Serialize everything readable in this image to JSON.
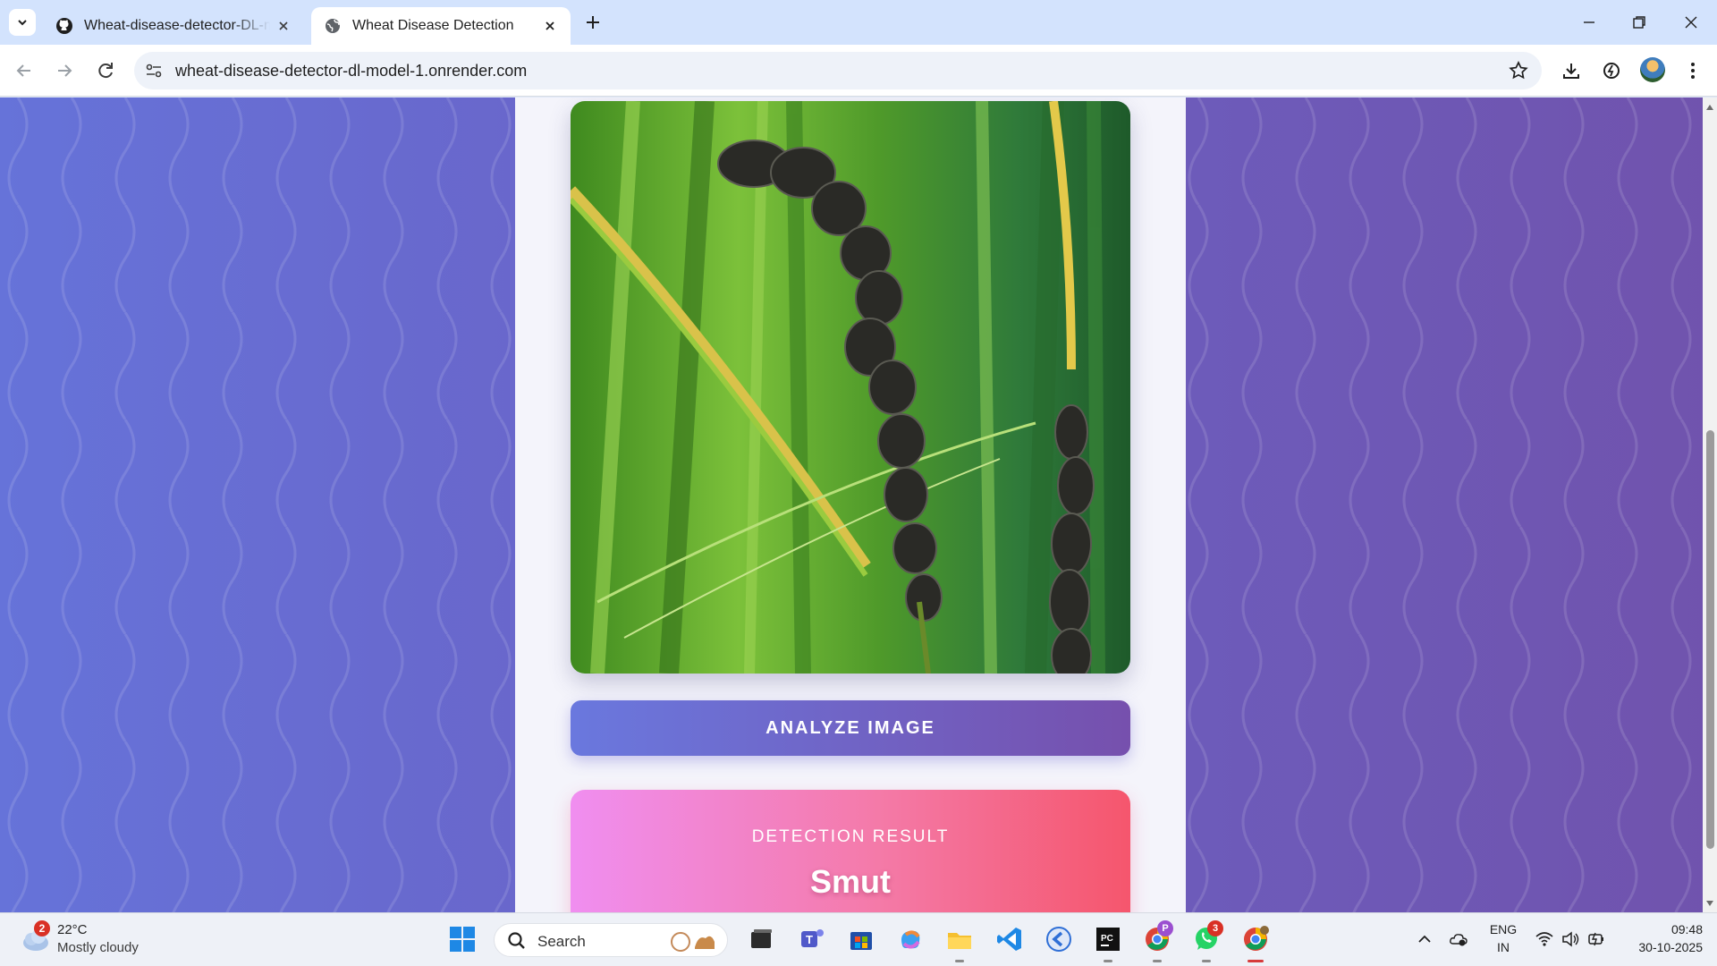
{
  "browser": {
    "tabs": [
      {
        "title": "Wheat-disease-detector-DL-model",
        "active": false
      },
      {
        "title": "Wheat Disease Detection",
        "active": true
      }
    ],
    "url": "wheat-disease-detector-dl-model-1.onrender.com"
  },
  "page": {
    "analyze_button": "ANALYZE IMAGE",
    "result_label": "DETECTION RESULT",
    "result_value": "Smut",
    "colors": {
      "button_start": "#6a78de",
      "button_end": "#7650ad",
      "result_start": "#f08ef0",
      "result_end": "#f5566d"
    }
  },
  "taskbar": {
    "weather": {
      "temp": "22°C",
      "desc": "Mostly cloudy",
      "badge": "2"
    },
    "search_placeholder": "Search",
    "whatsapp_badge": "3",
    "chrome_profile_badge": "P",
    "language": {
      "line1": "ENG",
      "line2": "IN"
    },
    "time": "09:48",
    "date": "30-10-2025"
  }
}
